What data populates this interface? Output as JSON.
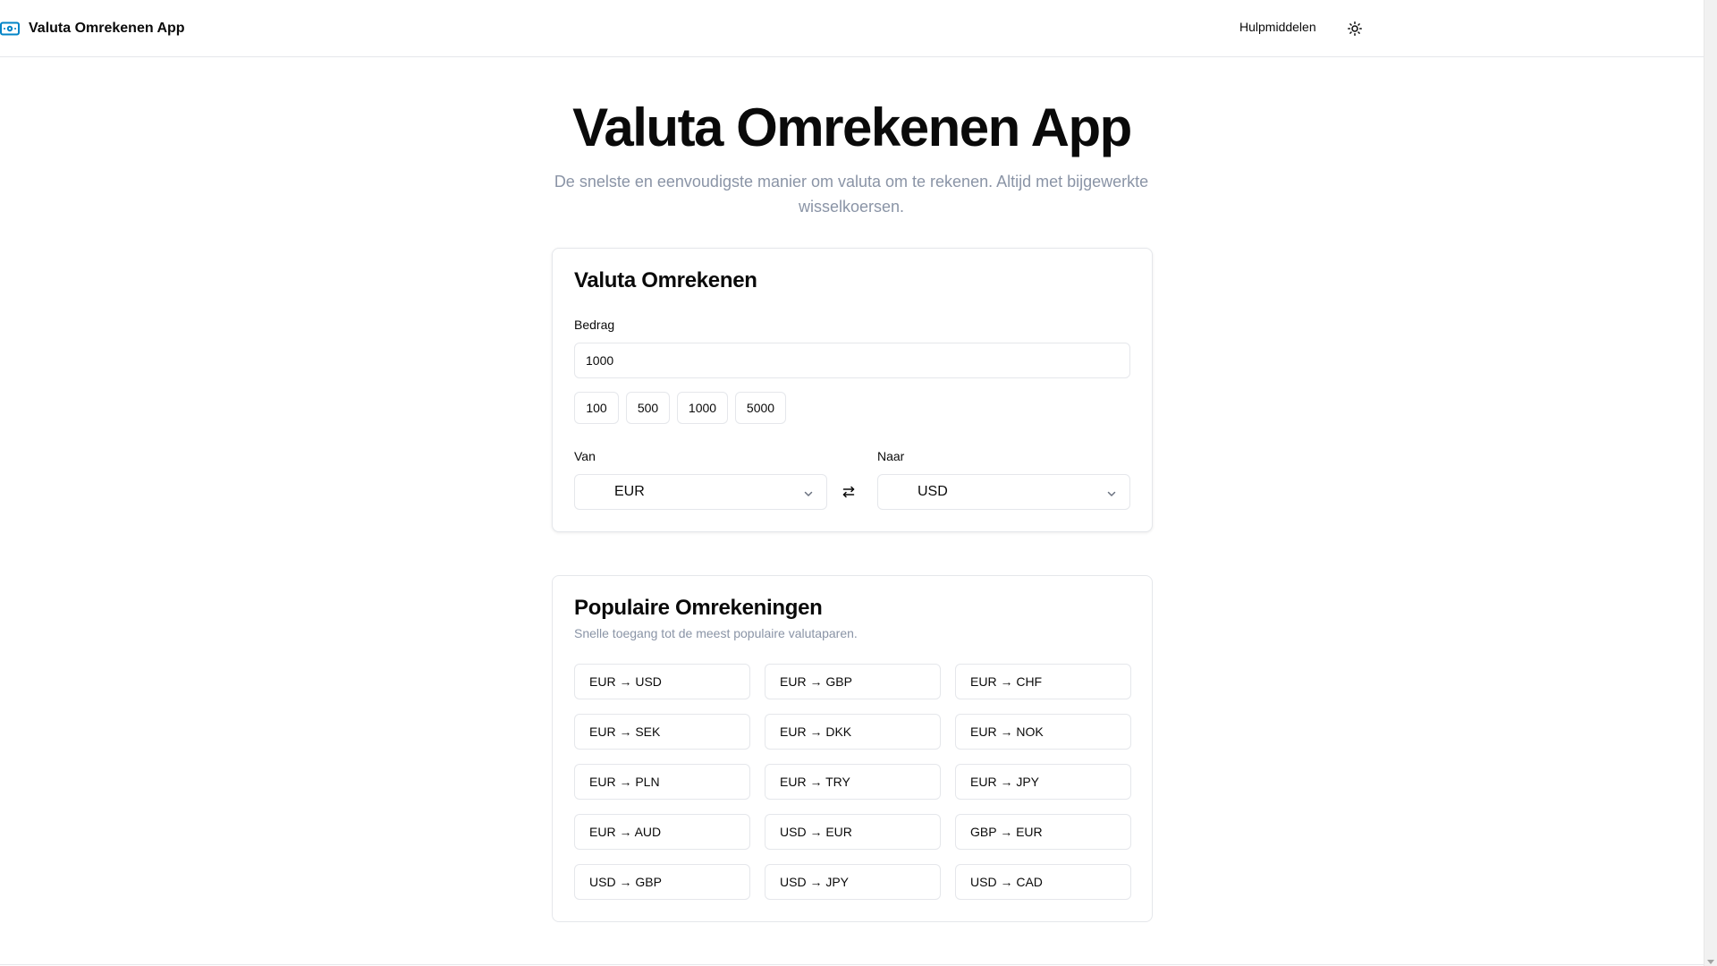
{
  "header": {
    "app_title": "Valuta Omrekenen App",
    "nav_tools": "Hulpmiddelen",
    "brand_icon": "banknote-icon",
    "theme_icon": "sun-icon"
  },
  "hero": {
    "title": "Valuta Omrekenen App",
    "subtitle": "De snelste en eenvoudigste manier om valuta om te rekenen. Altijd met bijgewerkte wisselkoersen."
  },
  "converter": {
    "title": "Valuta Omrekenen",
    "amount_label": "Bedrag",
    "amount_value": "1000",
    "quick_amounts": [
      "100",
      "500",
      "1000",
      "5000"
    ],
    "from_label": "Van",
    "from_value": "EUR",
    "to_label": "Naar",
    "to_value": "USD",
    "swap_icon": "swap-arrows-icon"
  },
  "popular": {
    "title": "Populaire Omrekeningen",
    "description": "Snelle toegang tot de meest populaire valutaparen.",
    "pairs": [
      "EUR → USD",
      "EUR → GBP",
      "EUR → CHF",
      "EUR → SEK",
      "EUR → DKK",
      "EUR → NOK",
      "EUR → PLN",
      "EUR → TRY",
      "EUR → JPY",
      "EUR → AUD",
      "USD → EUR",
      "GBP → EUR",
      "USD → GBP",
      "USD → JPY",
      "USD → CAD"
    ]
  },
  "colors": {
    "accent": "#0284c7",
    "muted_text": "#8a94a6",
    "border": "#e5e7eb"
  }
}
